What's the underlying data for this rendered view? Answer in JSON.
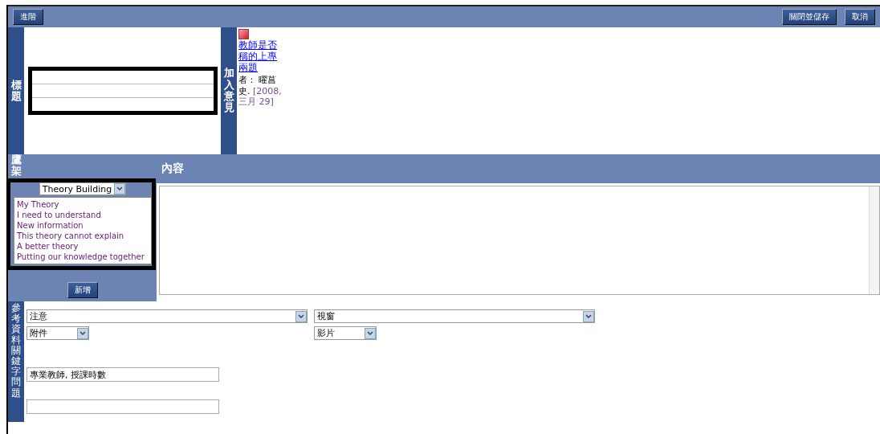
{
  "toolbar": {
    "left_buttons": [
      "進階"
    ],
    "right_buttons": [
      "關閉並儲存",
      "取消"
    ]
  },
  "title_section": {
    "label": "標題"
  },
  "comment_section": {
    "label": "加入意見",
    "link": "教師是否稱的上專兩題",
    "author": "者： 曜菖",
    "date_prefix": "史. ",
    "date": "[2008, 三月 29]"
  },
  "scaffold": {
    "label": "鷹架",
    "select": "Theory Building",
    "items": [
      "My Theory",
      "I need to understand",
      "New information",
      "This theory cannot explain",
      "A better theory",
      "Putting our knowledge together"
    ],
    "add_button": "新增"
  },
  "content": {
    "header": "內容"
  },
  "references": {
    "label": "參考資料關鍵字問題",
    "selects": [
      {
        "value": "注意",
        "kind": "wide"
      },
      {
        "value": "視窗",
        "kind": "wide"
      },
      {
        "value": "附件",
        "kind": "narrow"
      },
      {
        "value": "影片",
        "kind": "narrow"
      }
    ],
    "keywords": {
      "value": "專業教師, 授課時數"
    }
  }
}
